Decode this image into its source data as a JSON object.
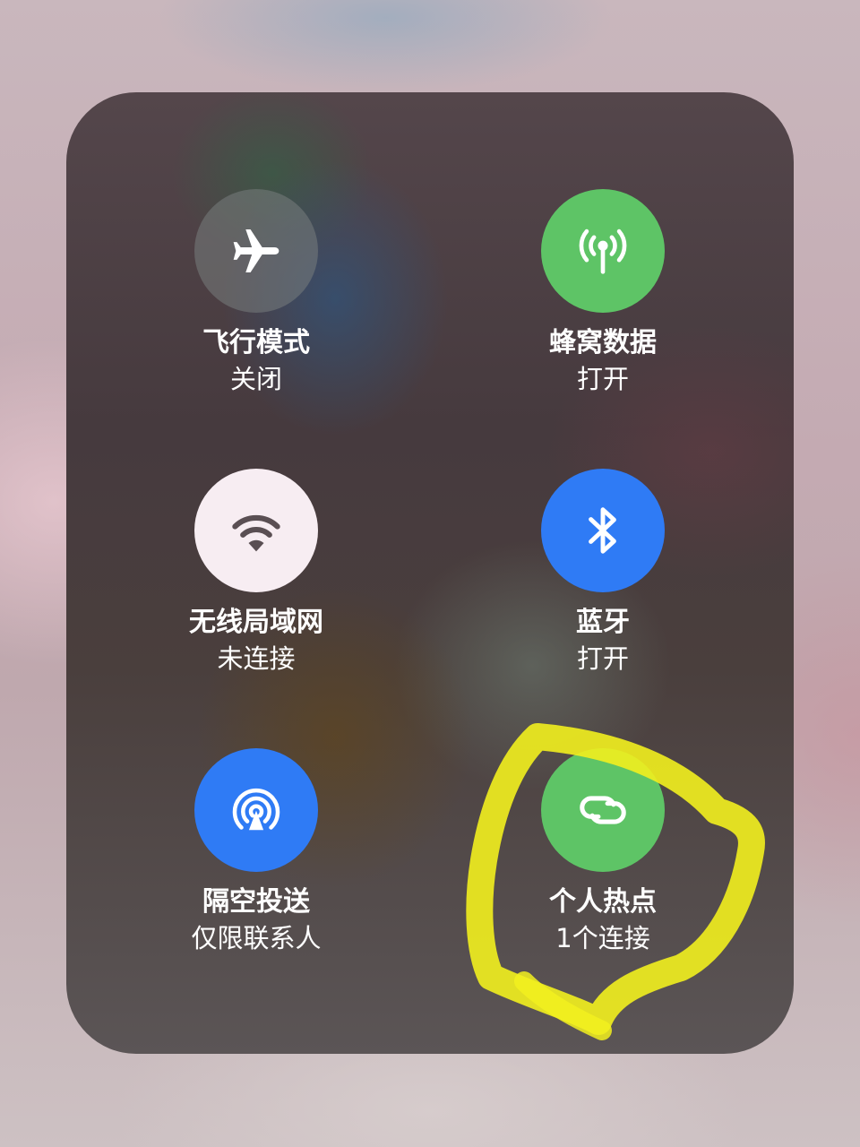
{
  "controls": [
    {
      "id": "airplane",
      "label": "飞行模式",
      "status": "关闭",
      "icon": "airplane-icon",
      "state": "off"
    },
    {
      "id": "cellular",
      "label": "蜂窝数据",
      "status": "打开",
      "icon": "cellular-antenna-icon",
      "state": "on"
    },
    {
      "id": "wifi",
      "label": "无线局域网",
      "status": "未连接",
      "icon": "wifi-icon",
      "state": "enabled-not-connected"
    },
    {
      "id": "bluetooth",
      "label": "蓝牙",
      "status": "打开",
      "icon": "bluetooth-icon",
      "state": "on"
    },
    {
      "id": "airdrop",
      "label": "隔空投送",
      "status": "仅限联系人",
      "icon": "airdrop-icon",
      "state": "contacts-only"
    },
    {
      "id": "hotspot",
      "label": "个人热点",
      "status": "1个连接",
      "icon": "hotspot-link-icon",
      "state": "on"
    }
  ],
  "colors": {
    "green": "#5ec466",
    "blue": "#2f7bf5",
    "white": "#f7edf2",
    "gray": "#787d7d",
    "highlighter": "#f2f01e"
  }
}
